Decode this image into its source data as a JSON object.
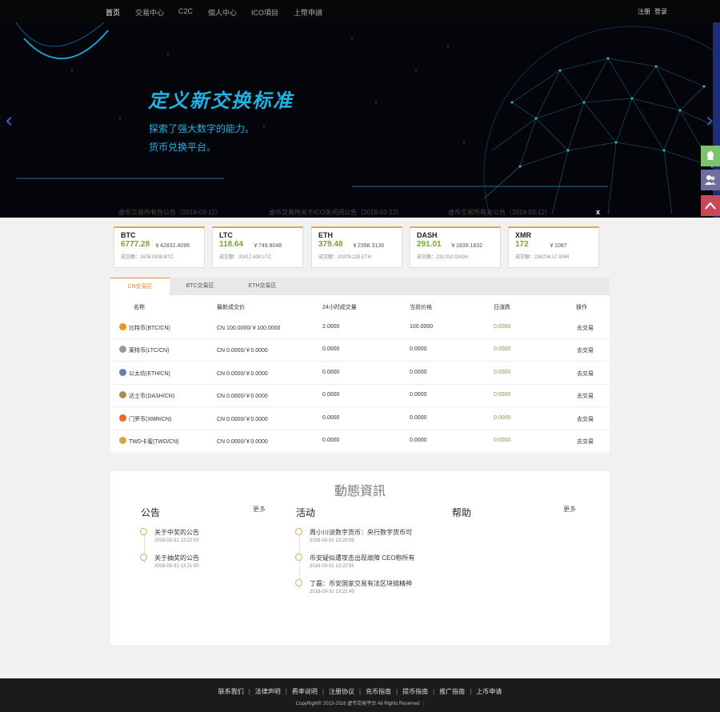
{
  "nav": {
    "items": [
      "首页",
      "交易中心",
      "C2C",
      "個人中心",
      "ICO項目",
      "上幣申請"
    ],
    "active": "首页",
    "register": "注册",
    "login": "登录"
  },
  "hero": {
    "title": "定义新交换标准",
    "line1": "探索了强大数字的能力。",
    "line2": "货币兑换平台。",
    "news": [
      "虚币交易所有告公告（2018-03-12）",
      "虚币交易所关于ICO关闭闭公告（2018-03-12）",
      "虚币交易所有关公告（2018-03-12）"
    ],
    "close": "x",
    "prev": "‹",
    "next": "›"
  },
  "tickers": [
    {
      "symbol": "BTC",
      "price": "6777.28",
      "cny": "￥42832.4096",
      "volume": "成交额：1676.0538 BTC"
    },
    {
      "symbol": "LTC",
      "price": "118.64",
      "cny": "￥749.8048",
      "volume": "成交额：32417.430 LTC"
    },
    {
      "symbol": "ETH",
      "price": "379.48",
      "cny": "￥2398.3136",
      "volume": "成交额：20379.225 ETH"
    },
    {
      "symbol": "DASH",
      "price": "291.01",
      "cny": "￥1839.1832",
      "volume": "成交额：233.010 DASH"
    },
    {
      "symbol": "XMR",
      "price": "172",
      "cny": "￥1087",
      "volume": "成交额：236704.17 XMR"
    }
  ],
  "market": {
    "tabs": [
      "CN交易区",
      "BTC交易区",
      "ETH交易区"
    ],
    "headers": [
      "名称",
      "最新成交价",
      "24小时成交量",
      "当前价格",
      "日涨跌",
      "操作"
    ],
    "rows": [
      {
        "name": "比特币(BTC/CN)",
        "last": "CN 100.0000/￥100.0000",
        "vol": "2.0000",
        "price": "100.0000",
        "change": "0.0000",
        "action": "去交易",
        "color": "#f7931a"
      },
      {
        "name": "莱特币(LTC/CN)",
        "last": "CN 0.0000/￥0.0000",
        "vol": "0.0000",
        "price": "0.0000",
        "change": "0.0000",
        "action": "去交易",
        "color": "#9a9a9a"
      },
      {
        "name": "以太坊(ETH/CN)",
        "last": "CN 0.0000/￥0.0000",
        "vol": "0.0000",
        "price": "0.0000",
        "change": "0.0000",
        "action": "去交易",
        "color": "#6b7bb8"
      },
      {
        "name": "达士币(DASH/CN)",
        "last": "CN 0.0000/￥0.0000",
        "vol": "0.0000",
        "price": "0.0000",
        "change": "0.0000",
        "action": "去交易",
        "color": "#b08a4a"
      },
      {
        "name": "门罗币(XMR/CN)",
        "last": "CN 0.0000/￥0.0000",
        "vol": "0.0000",
        "price": "0.0000",
        "change": "0.0000",
        "action": "去交易",
        "color": "#f26822"
      },
      {
        "name": "TWD卡蜜(TWD/CN)",
        "last": "CN 0.0000/￥0.0000",
        "vol": "0.0000",
        "price": "0.0000",
        "change": "0.0000",
        "action": "去交易",
        "color": "#d9a441"
      }
    ]
  },
  "news": {
    "title": "動態資訊",
    "announce_title": "公告",
    "activity_title": "活动",
    "help_title": "帮助",
    "more": "更多",
    "announce": [
      {
        "text": "关于中奖的公告",
        "date": "2018-03-31 13:22:03"
      },
      {
        "text": "关于抽奖的公告",
        "date": "2018-03-31 13:21:50"
      }
    ],
    "activity": [
      {
        "text": "周小川谈数字货币：央行数字货币可",
        "date": "2018-03-31 13:23:05"
      },
      {
        "text": "币安疑似遭攻击出现故障 CEO称所有",
        "date": "2018-03-31 13:22:55"
      },
      {
        "text": "丁磊：币安国家交易有法区块链精神",
        "date": "2018-03-31 13:22:45"
      }
    ]
  },
  "footer": {
    "links": [
      "联系我们",
      "法律声明",
      "费率说明",
      "注册协议",
      "充币指南",
      "提币指南",
      "推广指南",
      "上币申请"
    ],
    "copyright": "CopyRight© 2013-2016 虚币交易平台 All Rights Reserved",
    "bar": "|"
  },
  "colors": {
    "accent": "#e2a650",
    "up": "#7ba42e",
    "hero_text": "#1fb3e6"
  }
}
